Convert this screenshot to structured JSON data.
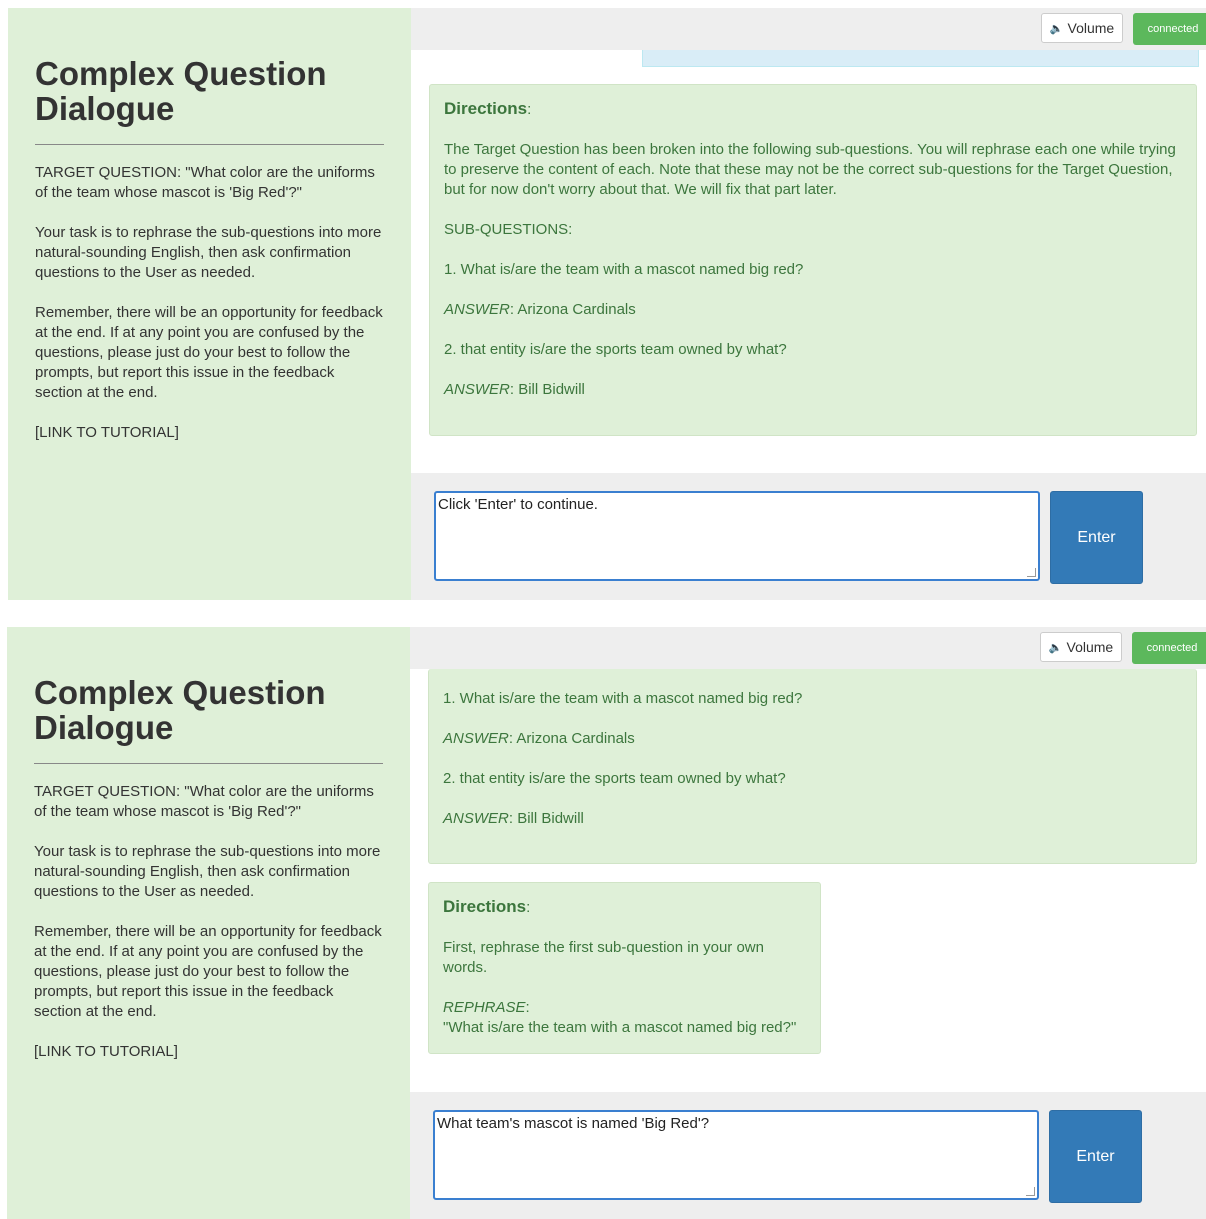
{
  "sidebar": {
    "title": "Complex Question Dialogue",
    "target_question": "TARGET QUESTION: \"What color are the uniforms of the team whose mascot is 'Big Red'?\"",
    "task": "Your task is to rephrase the sub-questions into more natural-sounding English, then ask confirmation questions to the User as needed.",
    "reminder": "Remember, there will be an opportunity for feedback at the end. If at any point you are confused by the questions, please just do your best to follow the prompts, but report this issue in the feedback section at the end.",
    "tutorial_link": "[LINK TO TUTORIAL]"
  },
  "topbar": {
    "volume_label": "Volume",
    "status_label": "connected"
  },
  "directions_label": "Directions",
  "panel1": {
    "intro": "The Target Question has been broken into the following sub-questions. You will rephrase each one while trying to preserve the content of each. Note that these may not be the correct sub-questions for the Target Question, but for now don't worry about that. We will fix that part later.",
    "subq_heading": "SUB-QUESTIONS:",
    "subq1": "1. What is/are the team with a mascot named big red?",
    "answer_label": "ANSWER",
    "answer1": "Arizona Cardinals",
    "subq2": "2. that entity is/are the sports team owned by what?",
    "answer2": "Bill Bidwill",
    "input_value": "Click 'Enter' to continue.",
    "enter_label": "Enter"
  },
  "panel2": {
    "subq1": "1. What is/are the team with a mascot named big red?",
    "answer_label": "ANSWER",
    "answer1": "Arizona Cardinals",
    "subq2": "2. that entity is/are the sports team owned by what?",
    "answer2": "Bill Bidwill",
    "instruction": "First, rephrase the first sub-question in your own words.",
    "rephrase_label": "REPHRASE",
    "rephrase_text": "\"What is/are the team with a mascot named big red?\"",
    "input_value": "What team's mascot is named 'Big Red'?",
    "enter_label": "Enter"
  }
}
